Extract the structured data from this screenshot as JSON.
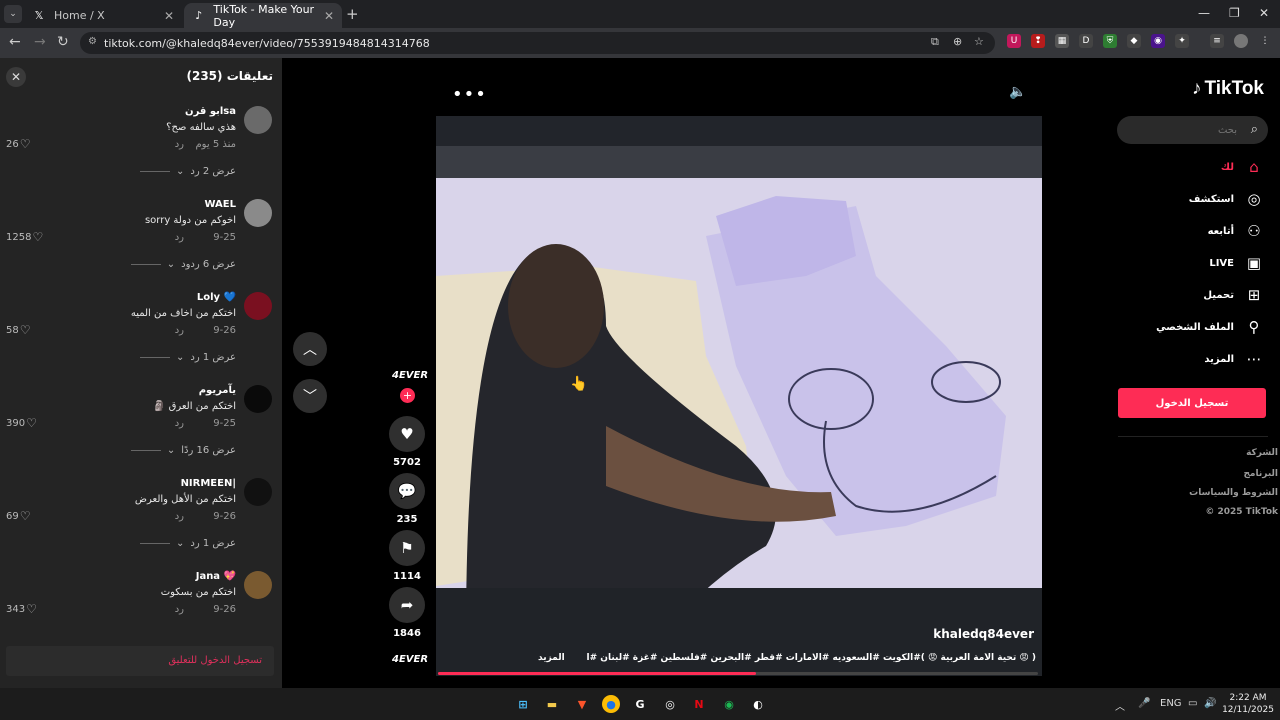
{
  "browser": {
    "tabs": [
      {
        "title": "Home / X",
        "icon": "x-logo-icon"
      },
      {
        "title": "TikTok - Make Your Day",
        "icon": "tiktok-logo-icon"
      }
    ],
    "url": "tiktok.com/@khaledq84ever/video/7553919484814314768"
  },
  "comments": {
    "title": "تعليقات (235)",
    "items": [
      {
        "name": "ابو قرنsa",
        "text": "هذي سالفه صح؟",
        "date": "منذ 5 يوم",
        "reply": "رد",
        "likes": "26",
        "view": "عرض 2 رد",
        "avatar_color": "#6a6a6a"
      },
      {
        "name": "WAEL",
        "text": "اخوكم من دولة sorry",
        "date": "9-25",
        "reply": "رد",
        "likes": "1258",
        "view": "عرض 6 ردود",
        "avatar_color": "#8a8a8a"
      },
      {
        "name": "Loly 💙",
        "text": "اختكم من اخاف من الميه",
        "date": "9-26",
        "reply": "رد",
        "likes": "58",
        "view": "عرض 1 رد",
        "avatar_color": "#7a1020"
      },
      {
        "name": "يآمريوم",
        "text": "اختكم من العرق 🗿",
        "date": "9-25",
        "reply": "رد",
        "likes": "390",
        "view": "عرض 16 ردًا",
        "avatar_color": "#0a0a0a"
      },
      {
        "name": "NIRMEEN|",
        "text": "اختكم من الأهل والعرض",
        "date": "9-26",
        "reply": "رد",
        "likes": "69",
        "view": "عرض 1 رد",
        "avatar_color": "#111111"
      },
      {
        "name": "Jana 💖",
        "text": "اختكم من بسكوت",
        "date": "9-26",
        "reply": "رد",
        "likes": "343",
        "view": "",
        "avatar_color": "#7a5a30"
      }
    ],
    "login_prompt": "تسجيل الدخول للتعليق"
  },
  "video": {
    "author": "khaledq84ever",
    "caption": "( 😡 تحية الأمة العربية 😡 )#الكويت #السعوديه #الامارات #قطر #البحرين #فلسطين #غزة #لبنان #اليمن ...",
    "more_label": "المزيد",
    "creator_badge": "4EVER",
    "sound_badge": "4EVER",
    "progress": 0.53,
    "actions": {
      "likes": "5702",
      "comments": "235",
      "saves": "1114",
      "shares": "1846"
    }
  },
  "sidebar": {
    "logo_text": "TikTok",
    "search_placeholder": "بحث",
    "items": [
      {
        "label": "لك",
        "icon": "home-icon",
        "active": true
      },
      {
        "label": "استكشف",
        "icon": "compass-icon"
      },
      {
        "label": "أتابعه",
        "icon": "following-icon"
      },
      {
        "label": "LIVE",
        "icon": "live-tv-icon"
      },
      {
        "label": "تحميل",
        "icon": "upload-icon"
      },
      {
        "label": "الملف الشخصي",
        "icon": "profile-icon"
      },
      {
        "label": "المزيد",
        "icon": "more-dots-icon"
      }
    ],
    "login_button": "تسجيل الدخول",
    "footer": [
      "الشركة",
      "البرنامج",
      "الشروط والسياسات",
      "© 2025 TikTok"
    ]
  },
  "taskbar": {
    "lang": "ENG",
    "time": "2:22 AM",
    "date": "12/11/2025"
  },
  "colors": {
    "accent": "#fe2c55",
    "panel": "#242424"
  }
}
